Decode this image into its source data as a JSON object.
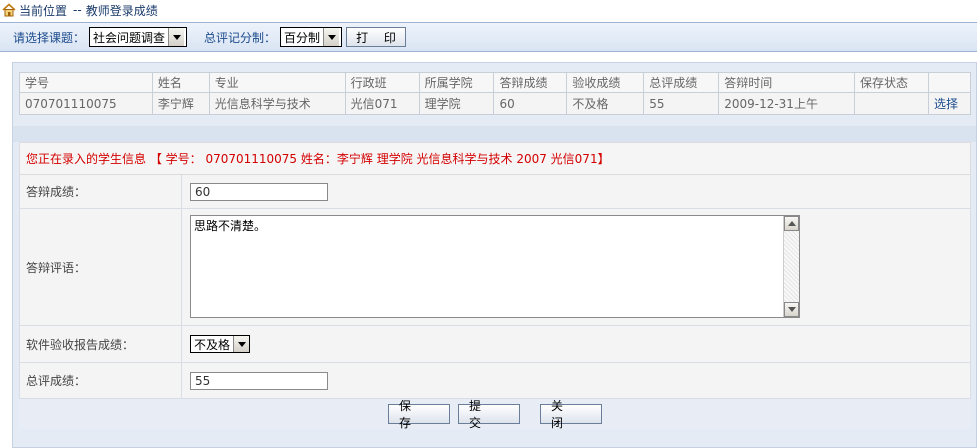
{
  "breadcrumb": {
    "location_label": "当前位置",
    "separator": "--",
    "page": "教师登录成绩",
    "home_icon": "home-icon"
  },
  "toolbar": {
    "topic_label": "请选择课题：",
    "topic_value": "社会问题调查",
    "score_label": "总评记分制：",
    "score_value": "百分制",
    "print_label": "打 印"
  },
  "grid": {
    "headers": [
      "学号",
      "姓名",
      "专业",
      "行政班",
      "所属学院",
      "答辩成绩",
      "验收成绩",
      "总评成绩",
      "答辩时间",
      "保存状态",
      ""
    ],
    "rows": [
      {
        "student_id": "070701110075",
        "name": "李宁辉",
        "major": "光信息科学与技术",
        "class": "光信071",
        "college": "理学院",
        "defense_score": "60",
        "acceptance_score": "不及格",
        "total_score": "55",
        "defense_time": "2009-12-31上午",
        "save_status": "",
        "action": "选择"
      }
    ]
  },
  "form": {
    "info_text": "您正在录入的学生信息 【 学号： 070701110075  姓名：李宁辉 理学院 光信息科学与技术 2007 光信071】",
    "defense_score_label": "答辩成绩：",
    "defense_score_value": "60",
    "defense_comment_label": "答辩评语：",
    "defense_comment_value": "思路不清楚。",
    "software_label": "软件验收报告成绩：",
    "software_value": "不及格",
    "total_label": "总评成绩：",
    "total_value": "55",
    "save_label": "保 存",
    "submit_label": "提 交",
    "close_label": "关 闭"
  },
  "colors": {
    "accent": "#1c4b8c",
    "info_text": "#d40000",
    "panel_bg": "#e5ebf5"
  }
}
